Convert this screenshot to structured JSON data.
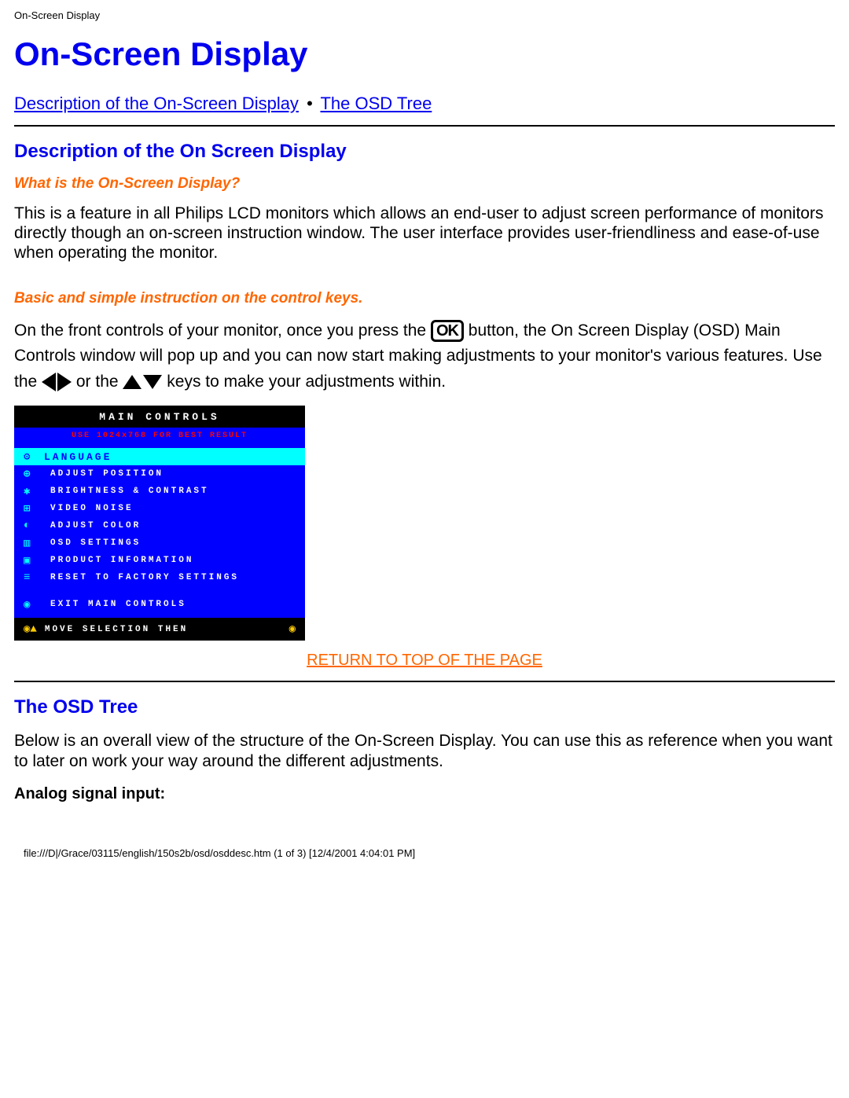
{
  "header_label": "On-Screen Display",
  "page_title": "On-Screen Display",
  "nav": {
    "link1": "Description of the On-Screen Display",
    "sep": "•",
    "link2": "The OSD Tree"
  },
  "section1": {
    "heading": "Description of the On Screen Display",
    "sub1": "What is the On-Screen Display?",
    "para1": "This is a feature in all Philips LCD monitors which allows an end-user to adjust screen performance of monitors directly though an on-screen instruction window. The user interface provides user-friendliness and ease-of-use when operating the monitor.",
    "sub2": "Basic and simple instruction on the control keys.",
    "p2a": "On the front controls of your monitor, once you press the ",
    "p2b": " button, the On Screen Display (OSD) Main Controls window will pop up and you can now start making adjustments to your monitor's various features. Use the ",
    "p2c": " or the ",
    "p2d": " keys to make your adjustments within.",
    "ok_label": "OK"
  },
  "osd": {
    "title": "MAIN CONTROLS",
    "subtitle": "USE 1024x768 FOR BEST RESULT",
    "items": [
      {
        "icon": "⚙",
        "label": "LANGUAGE",
        "selected": true
      },
      {
        "icon": "⊕",
        "label": "ADJUST POSITION",
        "selected": false
      },
      {
        "icon": "✱",
        "label": "BRIGHTNESS & CONTRAST",
        "selected": false
      },
      {
        "icon": "⊞",
        "label": "VIDEO NOISE",
        "selected": false
      },
      {
        "icon": "◐",
        "label": "ADJUST COLOR",
        "selected": false
      },
      {
        "icon": "▥",
        "label": "OSD SETTINGS",
        "selected": false
      },
      {
        "icon": "▣",
        "label": "PRODUCT INFORMATION",
        "selected": false
      },
      {
        "icon": "≡",
        "label": "RESET TO FACTORY SETTINGS",
        "selected": false
      }
    ],
    "exit": {
      "icon": "◉",
      "label": "EXIT MAIN CONTROLS"
    },
    "footer": {
      "icons": "◉▲",
      "text": "MOVE SELECTION THEN",
      "ok": "◉"
    }
  },
  "return_link": "RETURN TO TOP OF THE PAGE",
  "section2": {
    "heading": "The OSD Tree",
    "para": "Below is an overall view of the structure of the On-Screen Display. You can use this as reference when you want to later on work your way around the different adjustments.",
    "sub": "Analog signal input:"
  },
  "footer_path": "file:///D|/Grace/03115/english/150s2b/osd/osddesc.htm (1 of 3) [12/4/2001 4:04:01 PM]"
}
